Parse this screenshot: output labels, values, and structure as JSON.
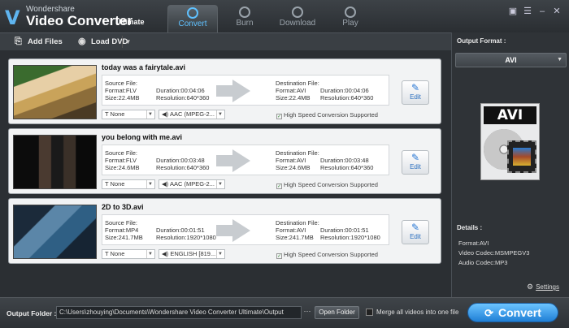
{
  "app": {
    "brand": "Wondershare",
    "name": "Video Converter",
    "edition": "Ultimate"
  },
  "tabs": [
    {
      "label": "Convert",
      "icon": "refresh-icon",
      "active": true
    },
    {
      "label": "Burn",
      "icon": "disc-icon"
    },
    {
      "label": "Download",
      "icon": "download-icon"
    },
    {
      "label": "Play",
      "icon": "play-icon"
    }
  ],
  "window_buttons": {
    "chat": "▣",
    "menu": "☰",
    "minimize": "–",
    "close": "✕"
  },
  "toolbar": {
    "add_files": "Add Files",
    "load_dvd": "Load DVD"
  },
  "items": [
    {
      "filename": "today was a fairytale.avi",
      "source_label": "Source File:",
      "source_format": "Format:FLV",
      "source_duration": "Duration:00:04:06",
      "source_size": "Size:22.4MB",
      "source_resolution": "Resolution:640*360",
      "dest_label": "Destination File:",
      "dest_format": "Format:AVI",
      "dest_duration": "Duration:00:04:06",
      "dest_size": "Size:22.4MB",
      "dest_resolution": "Resolution:640*360",
      "subtitle": "None",
      "audio": "AAC (MPEG-2...",
      "edit": "Edit",
      "hs": "High Speed Conversion Supported"
    },
    {
      "filename": "you belong with me.avi",
      "source_label": "Source File:",
      "source_format": "Format:FLV",
      "source_duration": "Duration:00:03:48",
      "source_size": "Size:24.6MB",
      "source_resolution": "Resolution:640*360",
      "dest_label": "Destination File:",
      "dest_format": "Format:AVI",
      "dest_duration": "Duration:00:03:48",
      "dest_size": "Size:24.6MB",
      "dest_resolution": "Resolution:640*360",
      "subtitle": "None",
      "audio": "AAC (MPEG-2...",
      "edit": "Edit",
      "hs": "High Speed Conversion Supported"
    },
    {
      "filename": "2D to 3D.avi",
      "source_label": "Source File:",
      "source_format": "Format:MP4",
      "source_duration": "Duration:00:01:51",
      "source_size": "Size:241.7MB",
      "source_resolution": "Resolution:1920*1080",
      "dest_label": "Destination File:",
      "dest_format": "Format:AVI",
      "dest_duration": "Duration:00:01:51",
      "dest_size": "Size:241.7MB",
      "dest_resolution": "Resolution:1920*1080",
      "subtitle": "None",
      "audio": "ENGLISH [819...",
      "edit": "Edit",
      "hs": "High Speed Conversion Supported"
    }
  ],
  "panel": {
    "output_format_label": "Output Format :",
    "format_value": "AVI",
    "format_icon_text": "AVI",
    "details_label": "Details :",
    "details": [
      "Format:AVI",
      "Video Codec:MSMPEGV3",
      "Audio Codec:MP3"
    ],
    "settings": "Settings"
  },
  "bottom": {
    "output_folder_label": "Output Folder :",
    "output_folder_path": "C:\\Users\\zhouying\\Documents\\Wondershare Video Converter Ultimate\\Output",
    "dots": "···",
    "open_folder": "Open Folder",
    "merge_label": "Merge all videos into one file",
    "convert": "Convert"
  }
}
